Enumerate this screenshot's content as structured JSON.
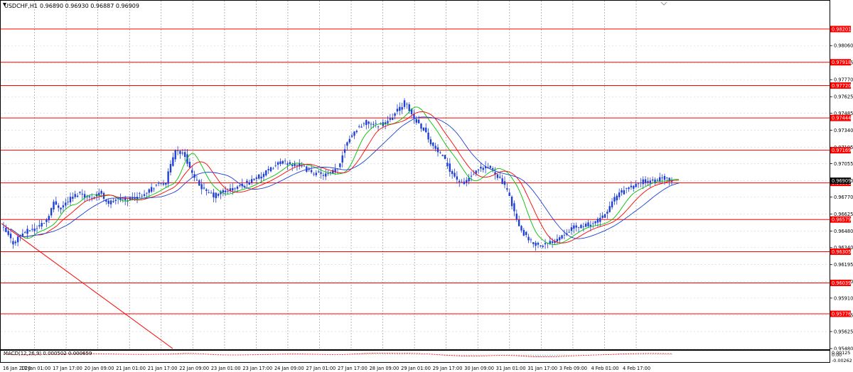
{
  "symbol_info": {
    "label": "USDCHF,H1",
    "values": "0.96890 0.96930 0.96887 0.96909"
  },
  "macd_info": {
    "label": "MACD(12,26,9) 0.000502 0.000659"
  },
  "colors": {
    "candles": "#1e3fd6",
    "horizontal_lines": "#ff0000",
    "price_tag_bg": "#ff0000",
    "price_tag_text": "#ffffff",
    "ma_fast": "#00c000",
    "ma_medium": "#ff0000",
    "ma_slow": "#1e3fd6",
    "grid": "#9a9a9a",
    "axis_text": "#000000",
    "macd_hist": "#c8c8c8",
    "macd_signal": "#ff0000"
  },
  "chart_data": {
    "type": "candlestick",
    "timeframe": "H1",
    "ylim": [
      0.9548,
      0.984
    ],
    "price_ticks": [
      "0.98060",
      "0.97915",
      "0.97770",
      "0.97625",
      "0.97485",
      "0.97340",
      "0.97195",
      "0.97055",
      "0.96910",
      "0.96770",
      "0.96625",
      "0.96480",
      "0.96340",
      "0.96195",
      "0.96050",
      "0.95910",
      "0.95765",
      "0.95625",
      "0.95480"
    ],
    "time_labels": [
      "16 Jan 2020",
      "17 Jan 01:00",
      "17 Jan 17:00",
      "20 Jan 09:00",
      "21 Jan 01:00",
      "21 Jan 17:00",
      "22 Jan 09:00",
      "23 Jan 01:00",
      "23 Jan 17:00",
      "24 Jan 09:00",
      "27 Jan 01:00",
      "27 Jan 17:00",
      "28 Jan 09:00",
      "29 Jan 01:00",
      "29 Jan 17:00",
      "30 Jan 09:00",
      "31 Jan 01:00",
      "31 Jan 17:00",
      "3 Feb 09:00",
      "4 Feb 01:00",
      "4 Feb 17:00"
    ],
    "horizontal_levels": [
      0.98201,
      0.97918,
      0.9772,
      0.97444,
      0.97169,
      0.96891,
      0.96579,
      0.96305,
      0.96039,
      0.95776
    ],
    "horizontal_level_labels": [
      "0.98201",
      "0.97918",
      "0.97720",
      "0.97444",
      "0.97169",
      "0.96891",
      "0.96579",
      "0.96305",
      "0.96039",
      "0.95776"
    ],
    "current_price": "0.96909",
    "close_path": [
      [
        0,
        0.965
      ],
      [
        4,
        0.9638
      ],
      [
        7,
        0.9645
      ],
      [
        10,
        0.9648
      ],
      [
        14,
        0.9651
      ],
      [
        18,
        0.9658
      ],
      [
        21,
        0.9672
      ],
      [
        24,
        0.9668
      ],
      [
        28,
        0.9676
      ],
      [
        32,
        0.9681
      ],
      [
        36,
        0.9676
      ],
      [
        40,
        0.9681
      ],
      [
        44,
        0.9672
      ],
      [
        48,
        0.9675
      ],
      [
        52,
        0.9675
      ],
      [
        56,
        0.9678
      ],
      [
        60,
        0.9682
      ],
      [
        64,
        0.9687
      ],
      [
        68,
        0.969
      ],
      [
        72,
        0.9718
      ],
      [
        76,
        0.9712
      ],
      [
        80,
        0.9692
      ],
      [
        84,
        0.9683
      ],
      [
        88,
        0.9678
      ],
      [
        92,
        0.9682
      ],
      [
        96,
        0.9684
      ],
      [
        100,
        0.9687
      ],
      [
        104,
        0.9692
      ],
      [
        108,
        0.9695
      ],
      [
        112,
        0.9701
      ],
      [
        116,
        0.9707
      ],
      [
        120,
        0.9705
      ],
      [
        124,
        0.9704
      ],
      [
        128,
        0.9699
      ],
      [
        132,
        0.9697
      ],
      [
        136,
        0.9696
      ],
      [
        140,
        0.9701
      ],
      [
        144,
        0.9725
      ],
      [
        148,
        0.9735
      ],
      [
        152,
        0.9741
      ],
      [
        156,
        0.9738
      ],
      [
        160,
        0.9741
      ],
      [
        164,
        0.9748
      ],
      [
        168,
        0.9758
      ],
      [
        172,
        0.9744
      ],
      [
        176,
        0.9735
      ],
      [
        180,
        0.972
      ],
      [
        184,
        0.9711
      ],
      [
        188,
        0.9697
      ],
      [
        192,
        0.9688
      ],
      [
        196,
        0.9695
      ],
      [
        200,
        0.9701
      ],
      [
        204,
        0.9702
      ],
      [
        208,
        0.9693
      ],
      [
        212,
        0.9678
      ],
      [
        216,
        0.9651
      ],
      [
        220,
        0.964
      ],
      [
        224,
        0.9636
      ],
      [
        228,
        0.9637
      ],
      [
        232,
        0.9642
      ],
      [
        236,
        0.9648
      ],
      [
        240,
        0.9652
      ],
      [
        244,
        0.9653
      ],
      [
        248,
        0.9655
      ],
      [
        252,
        0.9662
      ],
      [
        256,
        0.9676
      ],
      [
        260,
        0.9683
      ],
      [
        264,
        0.9686
      ],
      [
        268,
        0.9691
      ],
      [
        272,
        0.969
      ],
      [
        276,
        0.9693
      ],
      [
        280,
        0.9691
      ]
    ],
    "moving_averages": [
      {
        "role": "fast",
        "period_bars": 6
      },
      {
        "role": "medium",
        "period_bars": 12
      },
      {
        "role": "slow",
        "period_bars": 22
      }
    ],
    "macd": {
      "label": "MACD(12,26,9)",
      "ylim": [
        -0.00262,
        0.00125
      ],
      "ticks": [
        "0.00125",
        "0.00",
        "-0.00262"
      ]
    }
  }
}
